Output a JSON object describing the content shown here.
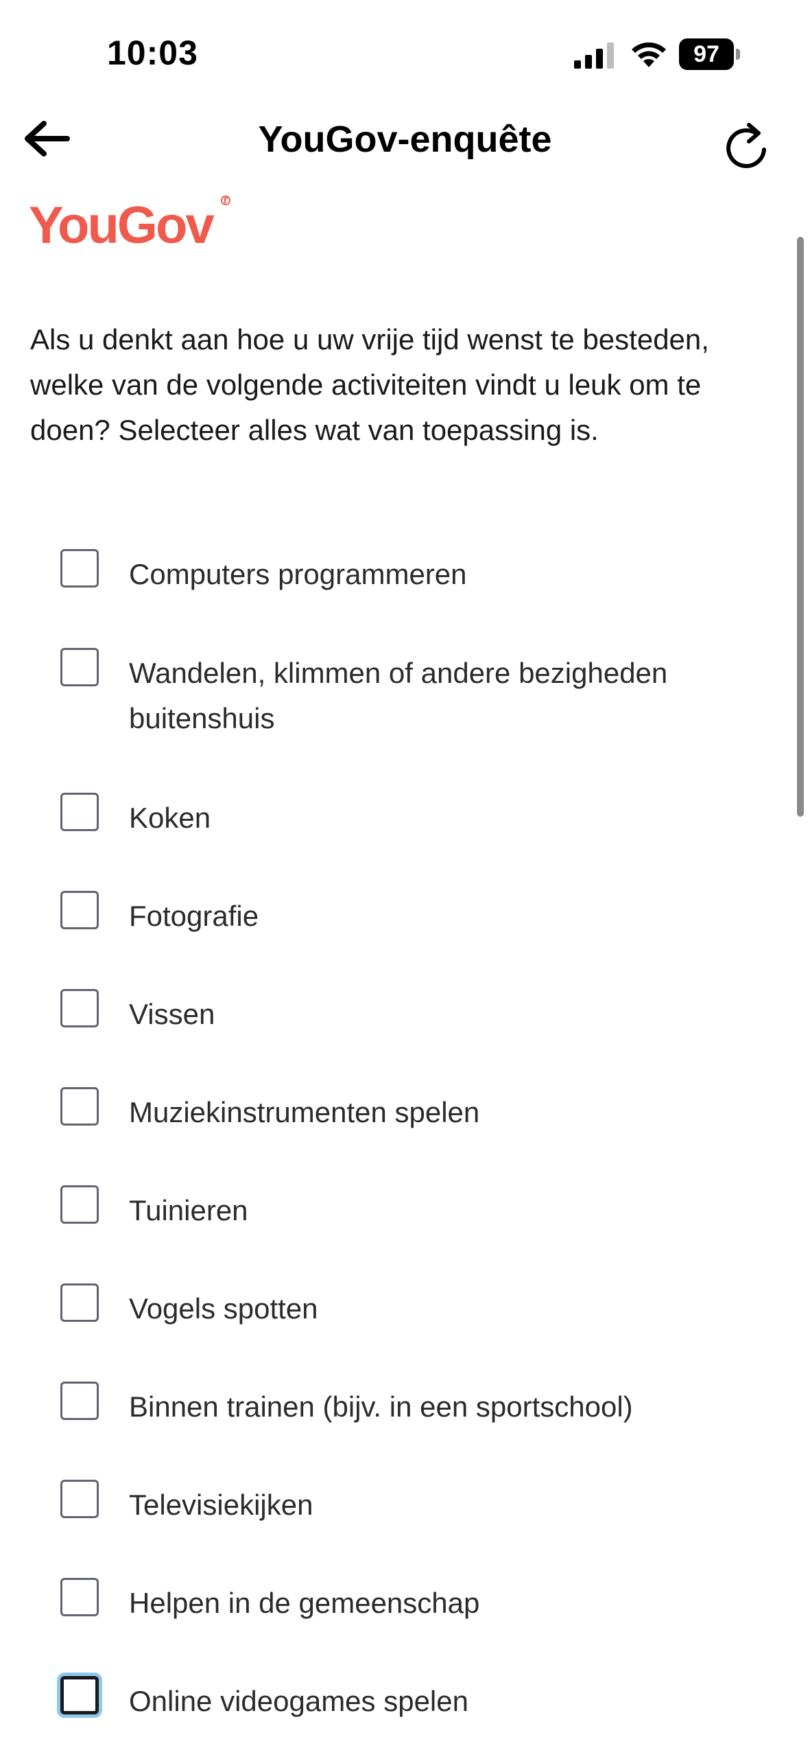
{
  "status_bar": {
    "time": "10:03",
    "battery_level": "97",
    "icons": [
      "signal-icon",
      "wifi-icon",
      "battery-icon"
    ]
  },
  "nav": {
    "title": "YouGov-enquête",
    "back_icon": "arrow-left-icon",
    "refresh_icon": "refresh-icon"
  },
  "logo": {
    "text": "YouGov",
    "color": "#ef5a4c"
  },
  "question": {
    "text": "Als u denkt aan hoe u uw vrije tijd wenst te besteden, welke van de volgende activiteiten vindt u leuk om te doen? Selecteer alles wat van toepassing is."
  },
  "options": [
    {
      "label": "Computers programmeren",
      "checked": false
    },
    {
      "label": "Wandelen, klimmen of andere bezigheden buitenshuis",
      "checked": false
    },
    {
      "label": "Koken",
      "checked": false
    },
    {
      "label": "Fotografie",
      "checked": false
    },
    {
      "label": "Vissen",
      "checked": false
    },
    {
      "label": "Muziekinstrumenten spelen",
      "checked": false
    },
    {
      "label": "Tuinieren",
      "checked": false
    },
    {
      "label": "Vogels spotten",
      "checked": false
    },
    {
      "label": "Binnen trainen (bijv. in een sportschool)",
      "checked": false
    },
    {
      "label": "Televisiekijken",
      "checked": false
    },
    {
      "label": "Helpen in de gemeenschap",
      "checked": false
    },
    {
      "label": "Online videogames spelen",
      "checked": false,
      "focused": true
    }
  ]
}
